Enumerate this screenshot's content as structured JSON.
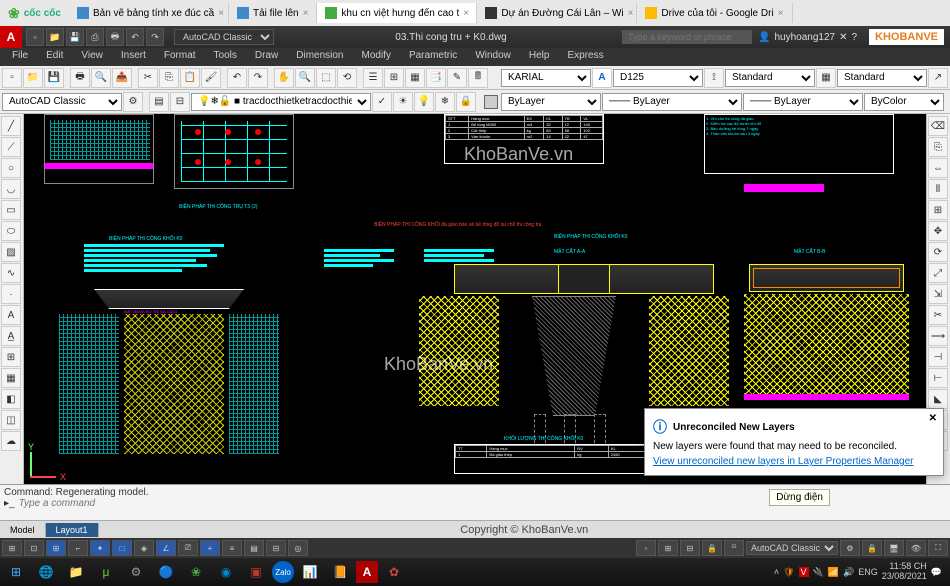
{
  "browser": {
    "name": "cốc cốc",
    "tabs": [
      {
        "label": "Bản vẽ bảng tính xe đúc cầ",
        "icon": "#48c"
      },
      {
        "label": "Tải file lên",
        "icon": "#48c"
      },
      {
        "label": "khu cn việt hưng đến cao t",
        "icon": "#4a4",
        "active": true
      },
      {
        "label": "Dự án Đường Cái Lân – Wi",
        "icon": "#333"
      },
      {
        "label": "Drive của tôi - Google Dri",
        "icon": "#fb0"
      }
    ]
  },
  "acad": {
    "workspace": "AutoCAD Classic",
    "title": "03.Thi cong tru + K0.dwg",
    "search_placeholder": "Type a keyword or phrase",
    "user": "huyhoang127",
    "sitelogo": "KHOBANVE"
  },
  "menu": [
    "File",
    "Edit",
    "View",
    "Insert",
    "Format",
    "Tools",
    "Draw",
    "Dimension",
    "Modify",
    "Parametric",
    "Window",
    "Help",
    "Express"
  ],
  "props": {
    "workspace2": "AutoCAD Classic",
    "layer": "tracdocthietke",
    "textstyle": "KARIAL",
    "dimstyle": "D125",
    "lw_standard": "Standard",
    "lt_bylayer": "ByLayer",
    "lw_bylayer": "ByLayer",
    "color": "ByColor",
    "standard2": "Standard"
  },
  "canvas": {
    "wm1": "KhoBanVe.vn",
    "wm2": "KhoBanVe.vn",
    "label1": "BIỆN PHÁP THI CÔNG TRỤ T3 (2)",
    "label2": "BIỆN PHÁP THI CÔNG KHỐI K0",
    "label3": "BIỆN PHÁP THI CÔNG KHỐI K0",
    "label_red": "BIỆN PHÁP THI CÔNG KHỐI đà giáo bản vẽ bê tông đổ tại chỗ thi công trụ",
    "mat_cat": "MẶT CẮT A-A",
    "mat_cat2": "MẶT CẮT B-B",
    "khoi_luong": "KHỐI LƯỢNG THI CÔNG KHỐI K0",
    "ghi_chu": "Ghi chú",
    "ucs_y": "Y",
    "ucs_x": "X"
  },
  "cmd": {
    "history": "Command: Regenerating model.",
    "placeholder": "Type a command"
  },
  "layout": {
    "tabs": [
      "Model",
      "Layout1"
    ],
    "active": "Layout1",
    "copyright": "Copyright © KhoBanVe.vn"
  },
  "status": {
    "workspace": "AutoCAD Classic"
  },
  "notif": {
    "title": "Unreconciled New Layers",
    "body": "New layers were found that may need to be reconciled.",
    "link": "View unreconciled new layers in Layer Properties Manager"
  },
  "tooltip": "Dừng điện",
  "system": {
    "time": "11:58 CH",
    "date": "23/08/2021",
    "lang": "ENG"
  }
}
